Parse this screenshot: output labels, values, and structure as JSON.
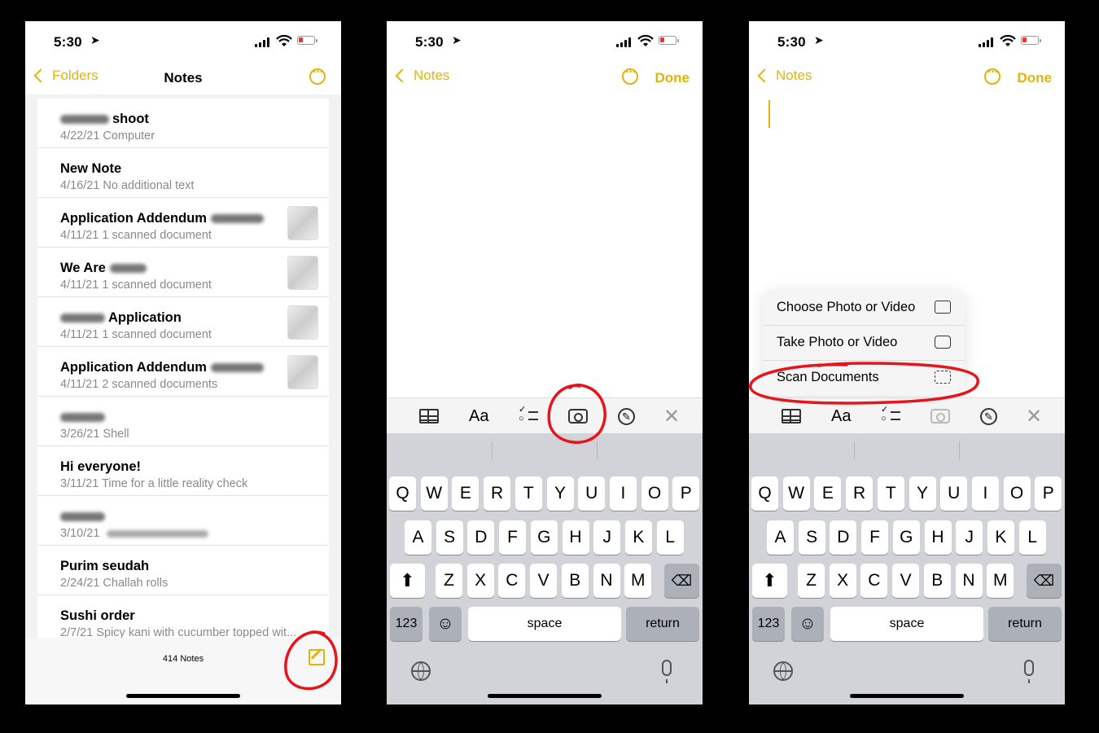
{
  "status": {
    "time": "5:30"
  },
  "notes_list": {
    "back_label": "Folders",
    "title": "Notes",
    "count": "414 Notes",
    "items": [
      {
        "title": "shoot",
        "subtitle": "4/22/21  Computer",
        "thumb": false
      },
      {
        "title": "New Note",
        "subtitle": "4/16/21  No additional text",
        "thumb": false
      },
      {
        "title": "Application Addendum",
        "subtitle": "4/11/21  1 scanned document",
        "thumb": true
      },
      {
        "title": "We Are",
        "subtitle": "4/11/21  1 scanned document",
        "thumb": true
      },
      {
        "title": "Application",
        "subtitle": "4/11/21  1 scanned document",
        "thumb": true
      },
      {
        "title": "Application Addendum",
        "subtitle": "4/11/21  2 scanned documents",
        "thumb": true
      },
      {
        "title": "",
        "subtitle": "3/26/21  Shell",
        "thumb": false
      },
      {
        "title": "Hi everyone!",
        "subtitle": "3/11/21  Time for a little reality check",
        "thumb": false
      },
      {
        "title": "",
        "subtitle": "3/10/21",
        "thumb": false
      },
      {
        "title": "Purim seudah",
        "subtitle": "2/24/21  Challah rolls",
        "thumb": false
      },
      {
        "title": "Sushi order",
        "subtitle": "2/7/21  Spicy kani with cucumber topped wit...",
        "thumb": false
      }
    ]
  },
  "editor": {
    "back_label": "Notes",
    "done_label": "Done"
  },
  "toolbar": {
    "format_label": "Aa"
  },
  "keyboard": {
    "row1": [
      "Q",
      "W",
      "E",
      "R",
      "T",
      "Y",
      "U",
      "I",
      "O",
      "P"
    ],
    "row2": [
      "A",
      "S",
      "D",
      "F",
      "G",
      "H",
      "J",
      "K",
      "L"
    ],
    "row3": [
      "Z",
      "X",
      "C",
      "V",
      "B",
      "N",
      "M"
    ],
    "numbers": "123",
    "space": "space",
    "return": "return",
    "emoji": "☺"
  },
  "camera_menu": {
    "items": [
      {
        "label": "Choose Photo or Video",
        "icon": "photo-library-icon"
      },
      {
        "label": "Take Photo or Video",
        "icon": "camera-icon"
      },
      {
        "label": "Scan Documents",
        "icon": "document-scan-icon"
      }
    ]
  },
  "colors": {
    "accent": "#e2b40a",
    "annotation": "#e8141c"
  }
}
